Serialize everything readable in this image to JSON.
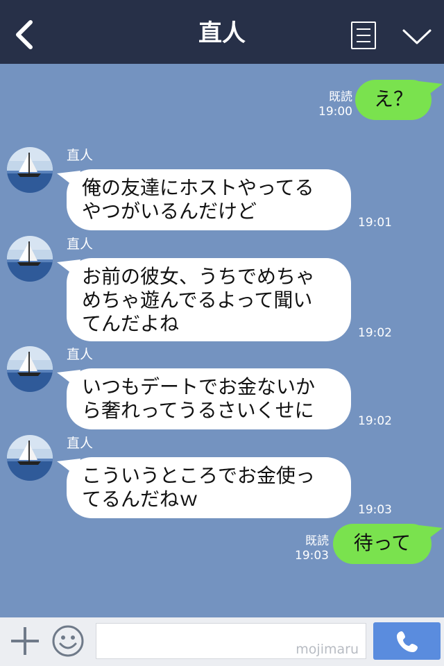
{
  "header": {
    "title": "直人",
    "back_icon": "back-chevron-icon",
    "menu_icon": "list-menu-icon",
    "collapse_icon": "chevron-down-icon",
    "bg_color": "#273048"
  },
  "chat": {
    "bg_color": "#7493c0",
    "messages": [
      {
        "direction": "outgoing",
        "text_lines": [
          "え？"
        ],
        "read_label": "既読",
        "time": "19:00"
      },
      {
        "direction": "incoming",
        "sender": "直人",
        "text_lines": [
          "俺の友達にホストやってる",
          "やつがいるんだけど"
        ],
        "time": "19:01"
      },
      {
        "direction": "incoming",
        "sender": "直人",
        "text_lines": [
          "お前の彼女、うちでめちゃ",
          "めちゃ遊んでるよって聞い",
          "てんだよね"
        ],
        "time": "19:02"
      },
      {
        "direction": "incoming",
        "sender": "直人",
        "text_lines": [
          "いつもデートでお金ないか",
          "ら奢れってうるさいくせに"
        ],
        "time": "19:02"
      },
      {
        "direction": "incoming",
        "sender": "直人",
        "text_lines": [
          "こういうところでお金使っ",
          "てるんだねｗ"
        ],
        "time": "19:03"
      },
      {
        "direction": "outgoing",
        "text_lines": [
          "待って"
        ],
        "read_label": "既読",
        "time": "19:03"
      }
    ],
    "outgoing_bubble_color": "#7ae24e",
    "incoming_bubble_color": "#ffffff"
  },
  "input_bar": {
    "plus_icon": "plus-icon",
    "sticker_icon": "smiley-icon",
    "watermark": "mojimaru",
    "call_icon": "phone-icon",
    "call_color": "#5a8cde"
  }
}
